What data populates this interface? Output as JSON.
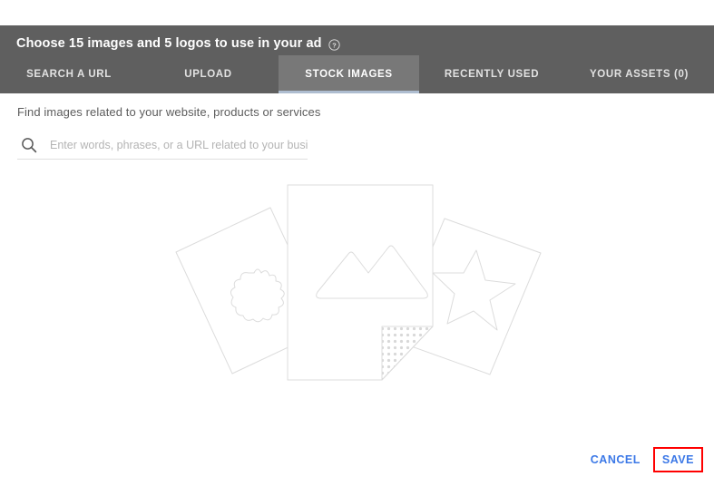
{
  "dialog": {
    "title": "Choose 15 images and 5 logos to use in your ad",
    "help_icon": "help-circle-icon",
    "header_bg": "#5f5f5f",
    "tabs": [
      {
        "label": "SEARCH A URL",
        "active": false
      },
      {
        "label": "UPLOAD",
        "active": false
      },
      {
        "label": "STOCK IMAGES",
        "active": true
      },
      {
        "label": "RECENTLY USED",
        "active": false
      },
      {
        "label": "YOUR ASSETS (0)",
        "active": false
      }
    ],
    "active_tab_underline_color": "#aebdd0"
  },
  "main": {
    "instruction": "Find images related to your website, products or services",
    "search": {
      "icon": "search-icon",
      "value": "",
      "placeholder": "Enter words, phrases, or a URL related to your business"
    },
    "empty_state": {
      "illustration": "stacked-photo-cards-illustration",
      "line_color": "#dcdcdc",
      "elements": [
        "sunburst-card",
        "photo-card-with-mountains",
        "star-card",
        "dotted-folded-corner"
      ]
    }
  },
  "footer": {
    "cancel_label": "CANCEL",
    "save_label": "SAVE",
    "link_color": "#3b78e7",
    "highlight_color": "#ff0000"
  }
}
